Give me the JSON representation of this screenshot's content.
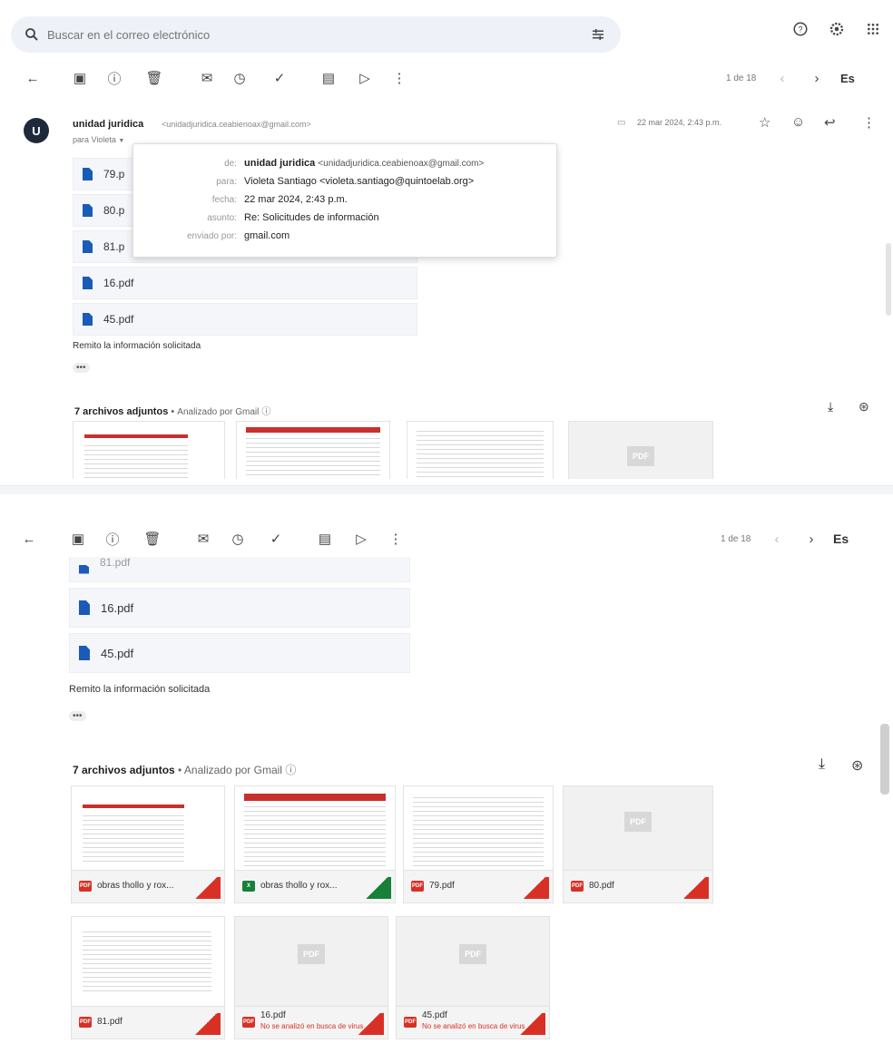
{
  "search": {
    "placeholder": "Buscar en el correo electrónico"
  },
  "toolbar": {
    "pager_top": "1 de 18",
    "pager_bottom": "1 de 18",
    "language": "Es"
  },
  "message": {
    "avatar_letter": "U",
    "sender_name": "unidad juridica",
    "sender_email": "<unidadjuridica.ceabienoax@gmail.com>",
    "recipient": "para Violeta",
    "date": "22 mar 2024, 2:43 p.m."
  },
  "details_popup": {
    "rows": [
      {
        "key": "de:",
        "value_bold": "unidad juridica",
        "value": "<unidadjuridica.ceabienoax@gmail.com>"
      },
      {
        "key": "para:",
        "value": "Violeta Santiago <violeta.santiago@quintoelab.org>"
      },
      {
        "key": "fecha:",
        "value": "22 mar 2024, 2:43 p.m."
      },
      {
        "key": "asunto:",
        "value": "Re: Solicitudes de información"
      },
      {
        "key": "enviado por:",
        "value": "gmail.com"
      }
    ]
  },
  "top_attachment_list": [
    "79.pdf",
    "80.pdf",
    "81.pdf",
    "16.pdf",
    "45.pdf"
  ],
  "top_attachment_partials": [
    "79.p",
    "80.p",
    "81.p"
  ],
  "bottom_attachment_list": [
    "81.pdf",
    "16.pdf",
    "45.pdf"
  ],
  "body_text": "Remito la información solicitada",
  "dots": "•••",
  "attachments_header": {
    "count_label": "7 archivos adjuntos",
    "separator": "•",
    "scanned": "Analizado por Gmail"
  },
  "attachments": [
    {
      "name": "obras thollo y rox...",
      "type": "pdf",
      "warning": ""
    },
    {
      "name": "obras thollo y rox...",
      "type": "xls",
      "warning": ""
    },
    {
      "name": "79.pdf",
      "type": "pdf",
      "warning": ""
    },
    {
      "name": "80.pdf",
      "type": "pdf",
      "warning": ""
    },
    {
      "name": "81.pdf",
      "type": "pdf",
      "warning": ""
    },
    {
      "name": "16.pdf",
      "type": "pdf",
      "warning": "No se analizó en busca de virus"
    },
    {
      "name": "45.pdf",
      "type": "pdf",
      "warning": "No se analizó en busca de virus"
    }
  ],
  "icons": {
    "pdf_label": "PDF",
    "xls_label": "X"
  },
  "colors": {
    "accent_blue": "#1a5bb8",
    "pdf_red": "#d93025",
    "xls_green": "#188038"
  }
}
